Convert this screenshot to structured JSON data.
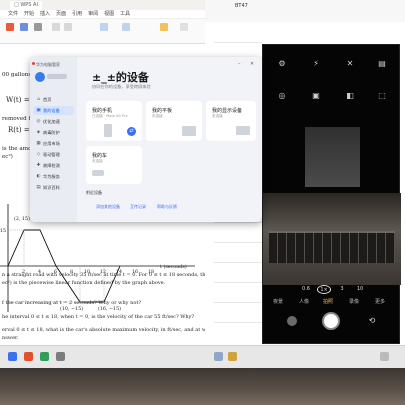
{
  "doc": {
    "tabs": [
      "□ WPS AI",
      "",
      ""
    ],
    "menu": [
      "文件",
      "开始",
      "插入",
      "页面",
      "引用",
      "审阅",
      "视图",
      "工具"
    ],
    "page": {
      "line1": "00 gallons of w",
      "line2": "W(t) = 95√",
      "line3": "removed from t",
      "line4": "R(t) = 275",
      "line5": "is the amount of w",
      "line6": "ec²)",
      "graph_labels": {
        "y_top": "(2, 15)",
        "y_mid": "15",
        "x_label": "t (seconds)",
        "x_ticks": [
          "2",
          "4",
          "6",
          "8",
          "10",
          "12",
          "14",
          "16",
          "18"
        ],
        "bottom_left": "(10, −15)",
        "bottom_right": "(16, −15)"
      },
      "para1": "n a straight road with velocity 35 ft/sec at time t = 0. For 0 ≤ t ≤ 18 seconds, the car's",
      "para2": "ec²) is the piecewise linear function defined by the graph above.",
      "para3": "f the car increasing at t = 2 seconds? Why or why not?",
      "para4": "he interval 0 ≤ t ≤ 18, when t = 0, is the velocity of the car 55 ft/sec? Why?",
      "para5": "erval 0 ≤ t ≤ 18, what is the car's absolute maximum velocity, in ft/sec, and at what time does",
      "para6": "nswer."
    }
  },
  "dialog": {
    "app_title": "华为电脑管家",
    "title": "±_±的设备",
    "subtitle": "协同在你的设备，享受跨屏体验",
    "sidebar": [
      {
        "label": "首页",
        "icon": "⌂"
      },
      {
        "label": "我的设备",
        "icon": "▣"
      },
      {
        "label": "优化加速",
        "icon": "◎"
      },
      {
        "label": "病毒防护",
        "icon": "◈"
      },
      {
        "label": "应用市场",
        "icon": "▦"
      },
      {
        "label": "驱动管理",
        "icon": "◇"
      },
      {
        "label": "故障检测",
        "icon": "✚"
      },
      {
        "label": "华为服务",
        "icon": "◐"
      },
      {
        "label": "知识百科",
        "icon": "▤"
      }
    ],
    "cards": [
      {
        "title": "我的手机",
        "sub": "已连接 · Mate 60 Pro"
      },
      {
        "title": "我的平板",
        "sub": "未连接"
      },
      {
        "title": "我的显示设备",
        "sub": "未连接"
      },
      {
        "title": "我的车",
        "sub": "未连接"
      }
    ],
    "badge": "⇄",
    "section": "附近设备",
    "links": [
      "添加其他设备",
      "互传记录",
      "帮助与反馈"
    ]
  },
  "phone": {
    "top_icons": [
      "⚙",
      "⚡",
      "✕",
      "▤",
      "◎",
      "▣",
      "◧",
      "⬚"
    ],
    "zoom": [
      "0.6",
      "1×",
      "3",
      "10"
    ],
    "modes": [
      "夜景",
      "人像",
      "拍照",
      "录像",
      "更多"
    ],
    "active_mode": "拍照"
  },
  "right_window": {
    "title": "BT47"
  },
  "colors": {
    "accent": "#3a6ff0",
    "dialog_bg": "#f1f3f8",
    "active_mode": "#f5c542"
  }
}
